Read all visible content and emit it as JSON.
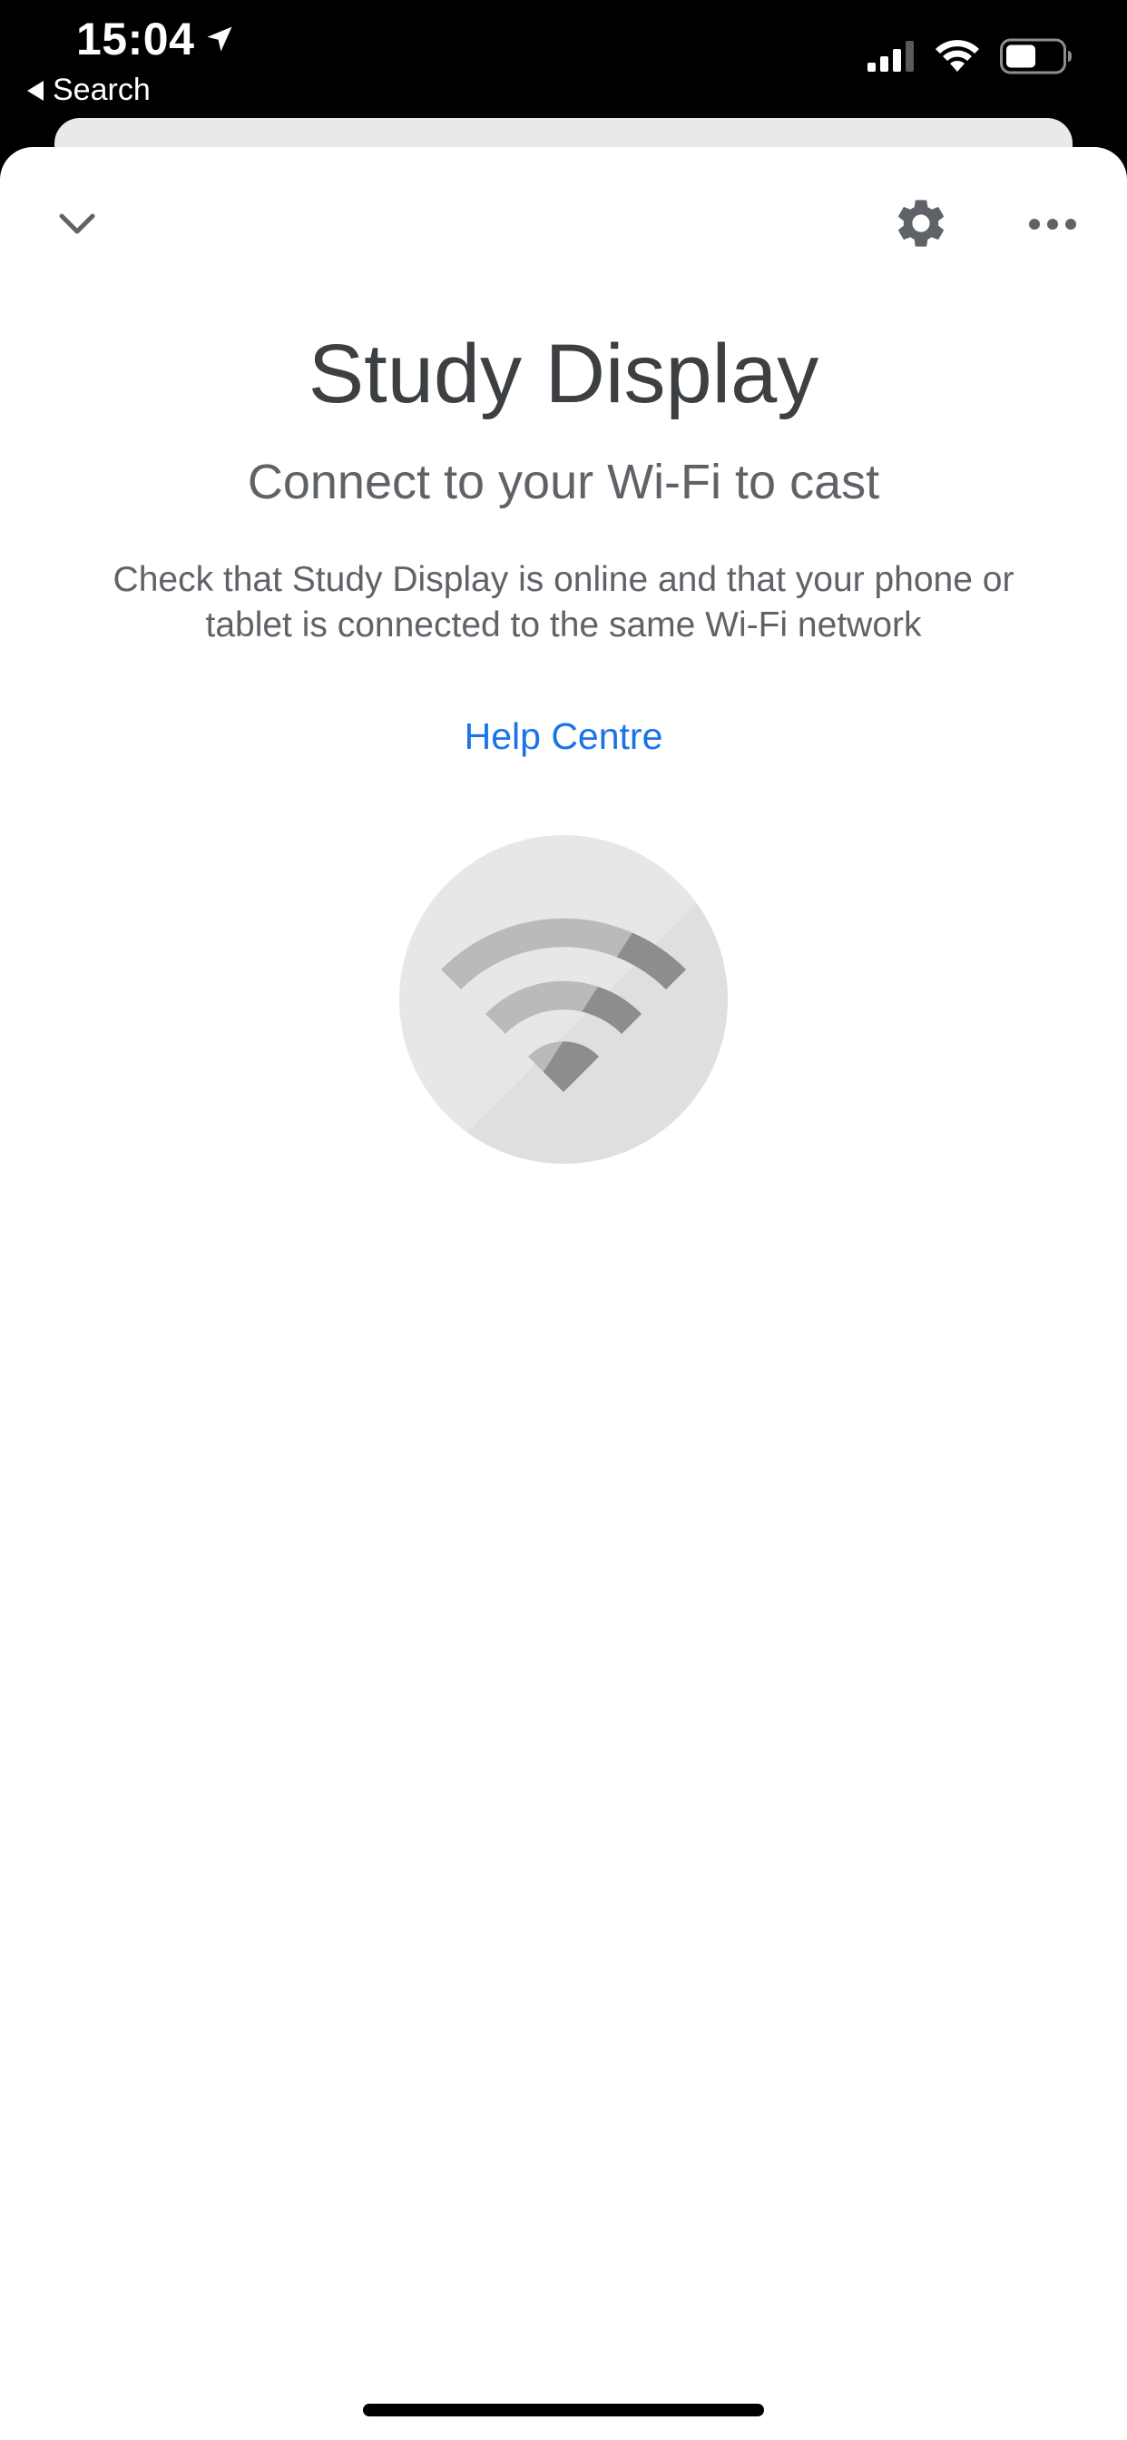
{
  "status_bar": {
    "time": "15:04",
    "back_label": "Search"
  },
  "toolbar": {
    "collapse_icon": "chevron-down-icon",
    "settings_icon": "gear-icon",
    "more_icon": "more-horizontal-icon"
  },
  "main": {
    "title": "Study Display",
    "subtitle": "Connect to your Wi-Fi to cast",
    "description": "Check that Study Display is online and that your phone or tablet is connected to the same Wi-Fi network",
    "help_link": "Help Centre",
    "illustration_icon": "wifi-off-icon"
  },
  "colors": {
    "link": "#1a73e8",
    "title": "#3c4043",
    "body": "#5f6368",
    "icon": "#5f6368"
  }
}
